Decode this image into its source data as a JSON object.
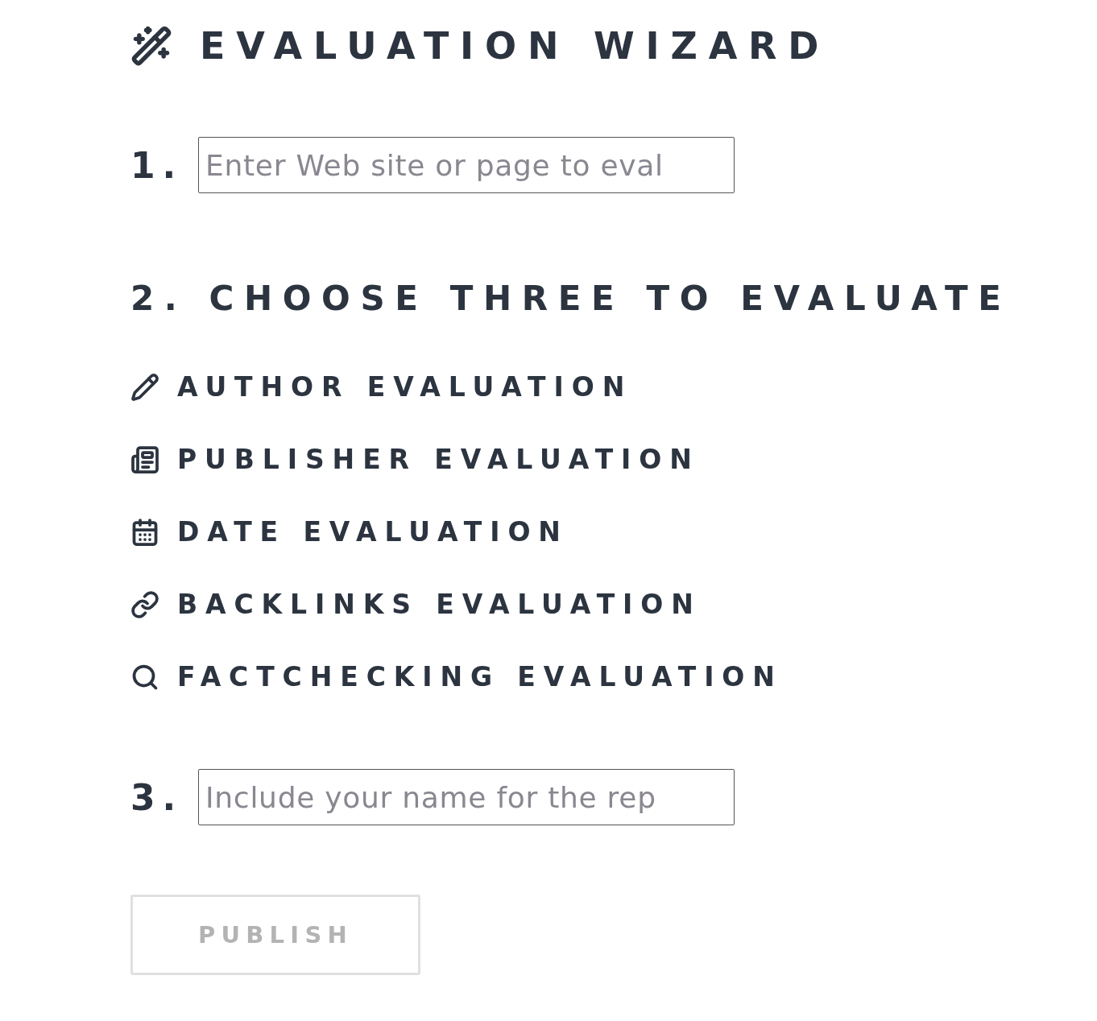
{
  "title": "EVALUATION WIZARD",
  "step1": {
    "number": "1.",
    "placeholder": "Enter Web site or page to eval"
  },
  "step2": {
    "heading": "2. CHOOSE THREE TO EVALUATE"
  },
  "evaluations": [
    {
      "label": "AUTHOR EVALUATION"
    },
    {
      "label": "PUBLISHER EVALUATION"
    },
    {
      "label": "DATE EVALUATION"
    },
    {
      "label": "BACKLINKS EVALUATION"
    },
    {
      "label": "FACTCHECKING EVALUATION"
    }
  ],
  "step3": {
    "number": "3.",
    "placeholder": "Include your name for the rep"
  },
  "publish": {
    "label": "PUBLISH",
    "disabled": true
  }
}
